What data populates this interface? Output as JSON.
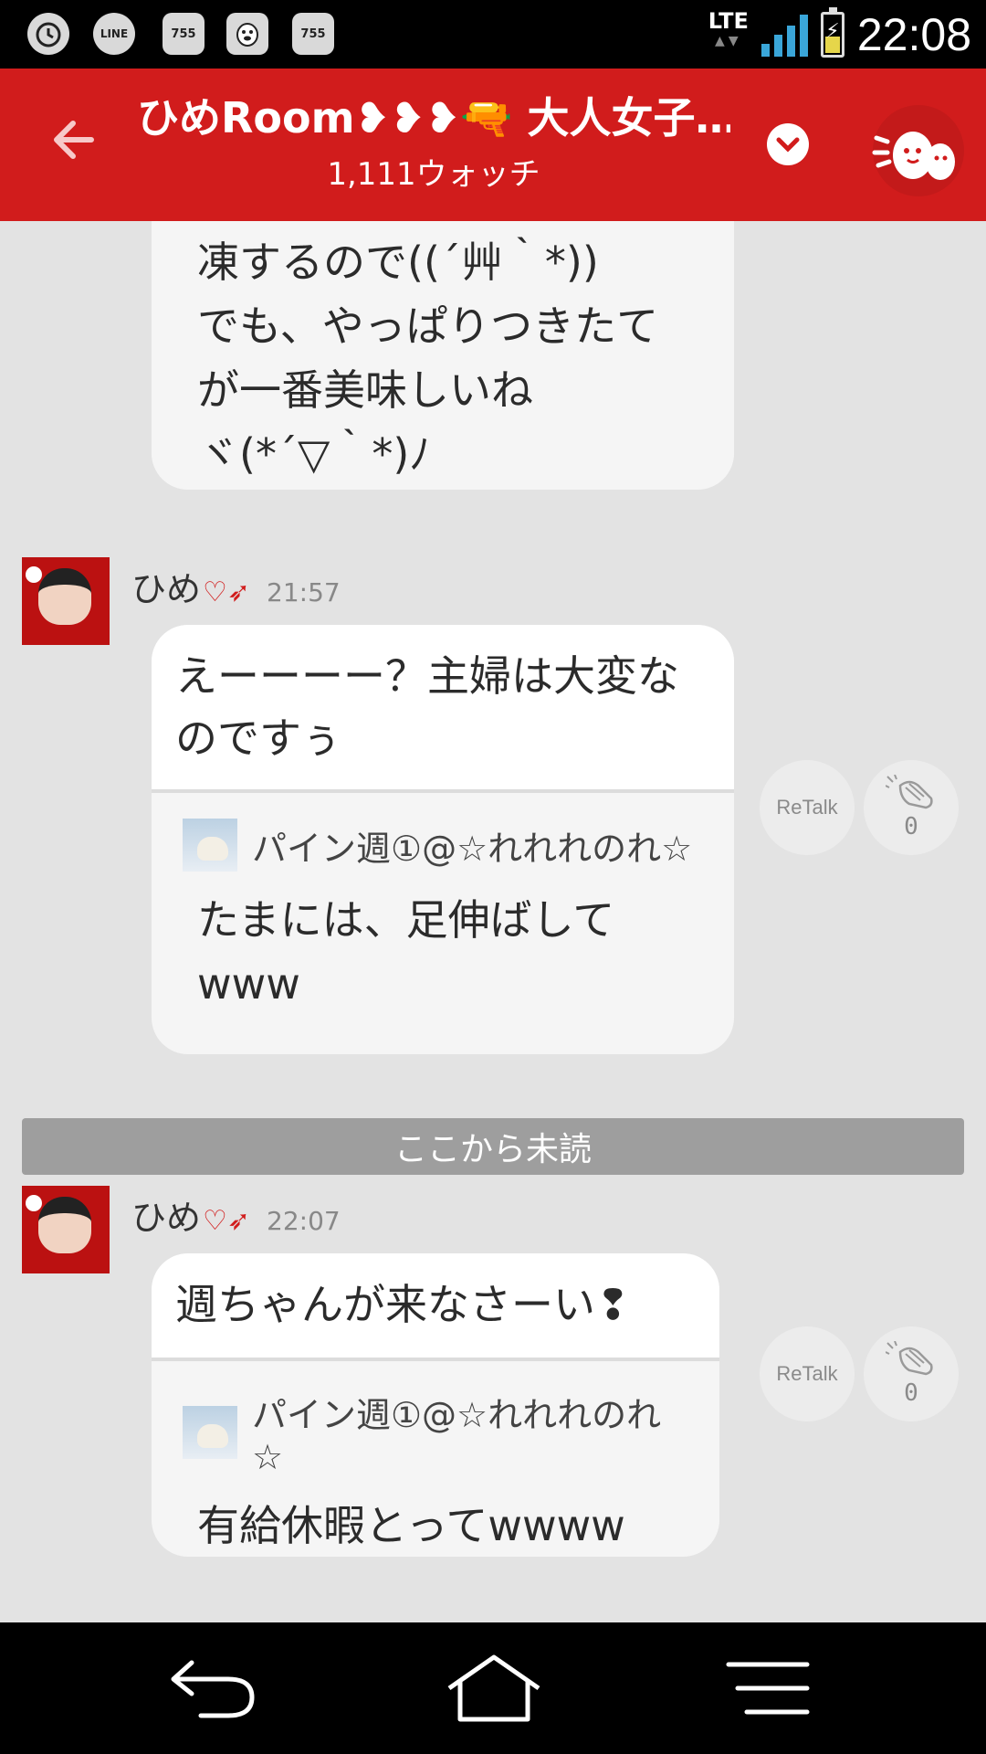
{
  "status_bar": {
    "notification_icons": [
      "alarm-icon",
      "line-app-icon",
      "app-icon",
      "duck-app-icon",
      "app-icon"
    ],
    "notification_labels": [
      "",
      "LINE",
      "755",
      "",
      "755"
    ],
    "network": "LTE",
    "clock": "22:08"
  },
  "header": {
    "title": "ひめRoom❥❥❥🔫 大人女子…",
    "watch_count": "1,111ウォッチ",
    "colors": {
      "brand": "#d11c1c"
    }
  },
  "messages": [
    {
      "text_lines": [
        "凍するので((´艸｀*))",
        "でも、やっぱりつきたて",
        "が一番美味しいね",
        "ヾ(*´▽｀*)ﾉ"
      ]
    },
    {
      "author": "ひめ",
      "time": "21:57",
      "text": "えーーーー？主婦は大変なのですぅ",
      "quote_author": "パイン週①@☆れれれのれ☆",
      "quote_text": "たまには、足伸ばしてwww",
      "retalk_label": "ReTalk",
      "clap_count": "0"
    },
    {
      "author": "ひめ",
      "time": "22:07",
      "text": "週ちゃんが来なさーい❢",
      "quote_author": "パイン週①@☆れれれのれ☆",
      "quote_text": "有給休暇とってwwww",
      "retalk_label": "ReTalk",
      "clap_count": "0"
    }
  ],
  "unread_divider": "ここから未読",
  "nav": [
    "back-icon",
    "home-icon",
    "menu-icon"
  ]
}
